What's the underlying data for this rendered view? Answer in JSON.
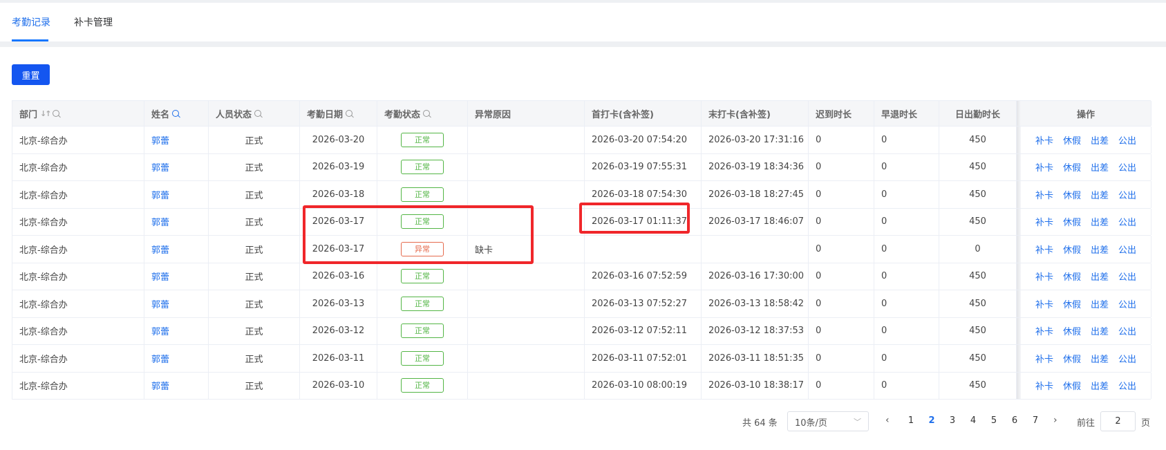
{
  "tabs": [
    {
      "label": "考勤记录",
      "active": true
    },
    {
      "label": "补卡管理",
      "active": false
    }
  ],
  "reset_label": "重置",
  "table": {
    "headers": {
      "dept": "部门",
      "name": "姓名",
      "staff_status": "人员状态",
      "date": "考勤日期",
      "att_status": "考勤状态",
      "reason": "异常原因",
      "first": "首打卡(含补签)",
      "last": "末打卡(含补签)",
      "late": "迟到时长",
      "early": "早退时长",
      "duration": "日出勤时长",
      "ops": "操作"
    },
    "ops_labels": [
      "补卡",
      "休假",
      "出差",
      "公出"
    ],
    "rows": [
      {
        "dept": "北京-综合办",
        "name": "郭蕾",
        "staff": "正式",
        "date": "2026-03-20",
        "status": "正常",
        "status_type": "ok",
        "reason": "",
        "first": "2026-03-20 07:54:20",
        "last": "2026-03-20 17:31:16",
        "late": "0",
        "early": "0",
        "duration": "450"
      },
      {
        "dept": "北京-综合办",
        "name": "郭蕾",
        "staff": "正式",
        "date": "2026-03-19",
        "status": "正常",
        "status_type": "ok",
        "reason": "",
        "first": "2026-03-19 07:55:31",
        "last": "2026-03-19 18:34:36",
        "late": "0",
        "early": "0",
        "duration": "450"
      },
      {
        "dept": "北京-综合办",
        "name": "郭蕾",
        "staff": "正式",
        "date": "2026-03-18",
        "status": "正常",
        "status_type": "ok",
        "reason": "",
        "first": "2026-03-18 07:54:30",
        "last": "2026-03-18 18:27:45",
        "late": "0",
        "early": "0",
        "duration": "450"
      },
      {
        "dept": "北京-综合办",
        "name": "郭蕾",
        "staff": "正式",
        "date": "2026-03-17",
        "status": "正常",
        "status_type": "ok",
        "reason": "",
        "first": "2026-03-17 01:11:37",
        "last": "2026-03-17 18:46:07",
        "late": "0",
        "early": "0",
        "duration": "450"
      },
      {
        "dept": "北京-综合办",
        "name": "郭蕾",
        "staff": "正式",
        "date": "2026-03-17",
        "status": "异常",
        "status_type": "bad",
        "reason": "缺卡",
        "first": "",
        "last": "",
        "late": "0",
        "early": "0",
        "duration": "0"
      },
      {
        "dept": "北京-综合办",
        "name": "郭蕾",
        "staff": "正式",
        "date": "2026-03-16",
        "status": "正常",
        "status_type": "ok",
        "reason": "",
        "first": "2026-03-16 07:52:59",
        "last": "2026-03-16 17:30:00",
        "late": "0",
        "early": "0",
        "duration": "450"
      },
      {
        "dept": "北京-综合办",
        "name": "郭蕾",
        "staff": "正式",
        "date": "2026-03-13",
        "status": "正常",
        "status_type": "ok",
        "reason": "",
        "first": "2026-03-13 07:52:27",
        "last": "2026-03-13 18:58:42",
        "late": "0",
        "early": "0",
        "duration": "450"
      },
      {
        "dept": "北京-综合办",
        "name": "郭蕾",
        "staff": "正式",
        "date": "2026-03-12",
        "status": "正常",
        "status_type": "ok",
        "reason": "",
        "first": "2026-03-12 07:52:11",
        "last": "2026-03-12 18:37:53",
        "late": "0",
        "early": "0",
        "duration": "450"
      },
      {
        "dept": "北京-综合办",
        "name": "郭蕾",
        "staff": "正式",
        "date": "2026-03-11",
        "status": "正常",
        "status_type": "ok",
        "reason": "",
        "first": "2026-03-11 07:52:01",
        "last": "2026-03-11 18:51:35",
        "late": "0",
        "early": "0",
        "duration": "450"
      },
      {
        "dept": "北京-综合办",
        "name": "郭蕾",
        "staff": "正式",
        "date": "2026-03-10",
        "status": "正常",
        "status_type": "ok",
        "reason": "",
        "first": "2026-03-10 08:00:19",
        "last": "2026-03-10 18:38:17",
        "late": "0",
        "early": "0",
        "duration": "450"
      }
    ]
  },
  "pagination": {
    "total": "共 64 条",
    "page_size": "10条/页",
    "pages": [
      "1",
      "2",
      "3",
      "4",
      "5",
      "6",
      "7"
    ],
    "current": "2",
    "goto_prefix": "前往",
    "goto_value": "2",
    "goto_suffix": "页"
  },
  "colors": {
    "accent": "#1456f0",
    "link": "#1f6feb",
    "ok": "#52b544",
    "bad": "#e56a4c",
    "highlight": "#f0262a"
  }
}
